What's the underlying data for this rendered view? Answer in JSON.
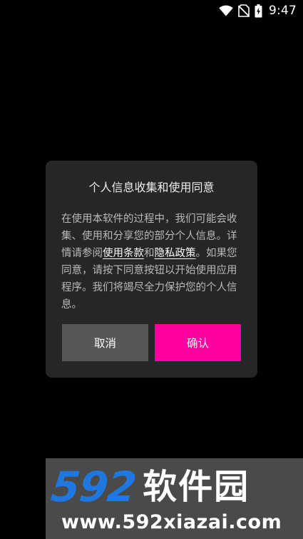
{
  "status_bar": {
    "time": "9:47",
    "icons": [
      "wifi-icon",
      "no-sim-icon",
      "battery-charging-icon"
    ]
  },
  "dialog": {
    "title": "个人信息收集和使用同意",
    "body_part1": "在使用本软件的过程中，我们可能会收集、使用和分享您的部分个人信息。详情请参阅",
    "terms_link": "使用条款",
    "and_text": "和",
    "privacy_link": "隐私政策",
    "body_part2": "。如果您同意，请按下同意按钮以开始使用应用程序。我们将竭尽全力保护您的个人信息。",
    "cancel_label": "取消",
    "confirm_label": "确认"
  },
  "watermark": {
    "logo_number": "592",
    "logo_text": "软件园",
    "url": "www.592xiazai.com"
  },
  "colors": {
    "background": "#000000",
    "dialog_bg": "#262626",
    "cancel_bg": "#575757",
    "confirm_bg": "#ff00a0",
    "logo_blue": "#1e78e0"
  }
}
